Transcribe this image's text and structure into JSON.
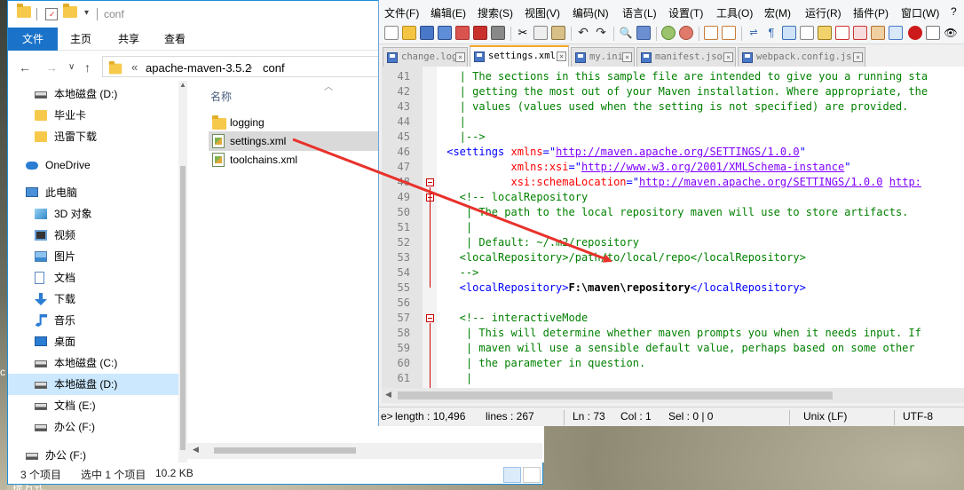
{
  "explorer": {
    "title": "conf",
    "ribbon_tabs": [
      "文件",
      "主页",
      "共享",
      "查看"
    ],
    "address": {
      "part1": "apache-maven-3.5.2",
      "part2": "conf"
    },
    "column_header": "名称",
    "nav_items": [
      {
        "label": "本地磁盘 (D:)",
        "icon": "drive-icon"
      },
      {
        "label": "毕业卡",
        "icon": "folder-icon"
      },
      {
        "label": "迅雷下载",
        "icon": "folder-icon"
      },
      {
        "label": "OneDrive",
        "icon": "onedrive-icon"
      },
      {
        "label": "此电脑",
        "icon": "computer-icon"
      },
      {
        "label": "3D 对象",
        "icon": "3d-objects-icon"
      },
      {
        "label": "视频",
        "icon": "video-icon"
      },
      {
        "label": "图片",
        "icon": "pictures-icon"
      },
      {
        "label": "文档",
        "icon": "documents-icon"
      },
      {
        "label": "下载",
        "icon": "download-icon"
      },
      {
        "label": "音乐",
        "icon": "music-icon"
      },
      {
        "label": "桌面",
        "icon": "desktop-icon"
      },
      {
        "label": "本地磁盘 (C:)",
        "icon": "drive-icon"
      },
      {
        "label": "本地磁盘 (D:)",
        "icon": "drive-icon"
      },
      {
        "label": "文档 (E:)",
        "icon": "drive-icon"
      },
      {
        "label": "办公 (F:)",
        "icon": "drive-icon"
      },
      {
        "label": "办公 (F:)",
        "icon": "drive-icon"
      }
    ],
    "files": [
      {
        "name": "logging",
        "type": "folder"
      },
      {
        "name": "settings.xml",
        "type": "xml"
      },
      {
        "name": "toolchains.xml",
        "type": "xml"
      }
    ],
    "status": {
      "count": "3 个项目",
      "selected": "选中 1 个项目",
      "size": "10.2 KB"
    }
  },
  "npp": {
    "menu": [
      "文件(F)",
      "编辑(E)",
      "搜索(S)",
      "视图(V)",
      "编码(N)",
      "语言(L)",
      "设置(T)",
      "工具(O)",
      "宏(M)",
      "运行(R)",
      "插件(P)",
      "窗口(W)",
      "?"
    ],
    "tabs": [
      "change.log",
      "settings.xml",
      "my.ini",
      "manifest.json",
      "webpack.config.js"
    ],
    "lines": [
      {
        "n": "41",
        "segs": [
          {
            "t": "   | The sections in this sample file are intended to give you a running sta",
            "c": "com"
          }
        ]
      },
      {
        "n": "42",
        "segs": [
          {
            "t": "   | getting the most out of your Maven installation. Where appropriate, the",
            "c": "com"
          }
        ]
      },
      {
        "n": "43",
        "segs": [
          {
            "t": "   | values (values used when the setting is not specified) are provided.",
            "c": "com"
          }
        ]
      },
      {
        "n": "44",
        "segs": [
          {
            "t": "   |",
            "c": "com"
          }
        ]
      },
      {
        "n": "45",
        "segs": [
          {
            "t": "   |-->",
            "c": "com"
          }
        ]
      },
      {
        "n": "46",
        "segs": [
          {
            "t": " <settings ",
            "c": "tag"
          },
          {
            "t": "xmlns",
            "c": "attr"
          },
          {
            "t": "=\"",
            "c": "tag"
          },
          {
            "t": "http://maven.apache.org/SETTINGS/1.0.0",
            "c": "str"
          },
          {
            "t": "\"",
            "c": "tag"
          }
        ]
      },
      {
        "n": "47",
        "segs": [
          {
            "t": "           ",
            "c": "tag"
          },
          {
            "t": "xmlns:xsi",
            "c": "attr"
          },
          {
            "t": "=\"",
            "c": "tag"
          },
          {
            "t": "http://www.w3.org/2001/XMLSchema-instance",
            "c": "str"
          },
          {
            "t": "\"",
            "c": "tag"
          }
        ]
      },
      {
        "n": "48",
        "segs": [
          {
            "t": "           ",
            "c": "tag"
          },
          {
            "t": "xsi:schemaLocation",
            "c": "attr"
          },
          {
            "t": "=\"",
            "c": "tag"
          },
          {
            "t": "http://maven.apache.org/SETTINGS/1.0.0",
            "c": "str"
          },
          {
            "t": " ",
            "c": "tag"
          },
          {
            "t": "http:",
            "c": "str"
          }
        ]
      },
      {
        "n": "49",
        "segs": [
          {
            "t": "   <!-- localRepository",
            "c": "com"
          }
        ]
      },
      {
        "n": "50",
        "segs": [
          {
            "t": "    | The path to the local repository maven will use to store artifacts.",
            "c": "com"
          }
        ]
      },
      {
        "n": "51",
        "segs": [
          {
            "t": "    |",
            "c": "com"
          }
        ]
      },
      {
        "n": "52",
        "segs": [
          {
            "t": "    | Default: ~/.m2/repository",
            "c": "com"
          }
        ]
      },
      {
        "n": "53",
        "segs": [
          {
            "t": "   <localRepository>/path/to/local/repo</localRepository>",
            "c": "com"
          }
        ]
      },
      {
        "n": "54",
        "segs": [
          {
            "t": "   -->",
            "c": "com"
          }
        ]
      },
      {
        "n": "55",
        "segs": [
          {
            "t": "   <localRepository>",
            "c": "tag"
          },
          {
            "t": "F:\\maven\\repository",
            "c": "txt"
          },
          {
            "t": "</localRepository>",
            "c": "tag"
          }
        ]
      },
      {
        "n": "56",
        "segs": [
          {
            "t": "",
            "c": "tag"
          }
        ]
      },
      {
        "n": "57",
        "segs": [
          {
            "t": "   <!-- interactiveMode",
            "c": "com"
          }
        ]
      },
      {
        "n": "58",
        "segs": [
          {
            "t": "    | This will determine whether maven prompts you when it needs input. If",
            "c": "com"
          }
        ]
      },
      {
        "n": "59",
        "segs": [
          {
            "t": "    | maven will use a sensible default value, perhaps based on some other",
            "c": "com"
          }
        ]
      },
      {
        "n": "60",
        "segs": [
          {
            "t": "    | the parameter in question.",
            "c": "com"
          }
        ]
      },
      {
        "n": "61",
        "segs": [
          {
            "t": "    |",
            "c": "com"
          }
        ]
      }
    ],
    "status": {
      "type": "e>",
      "length": "length : 10,496",
      "lines": "lines : 267",
      "ln": "Ln : 73",
      "col": "Col : 1",
      "sel": "Sel : 0 | 0",
      "eol": "Unix (LF)",
      "encoding": "UTF-8"
    }
  },
  "desktop": {
    "left_cut": "c",
    "bottom_cut": "提方式"
  },
  "colors": {
    "arrow": "#e8322b",
    "explorer_accent": "#1a73c9",
    "tab_accent": "#f5a623"
  }
}
